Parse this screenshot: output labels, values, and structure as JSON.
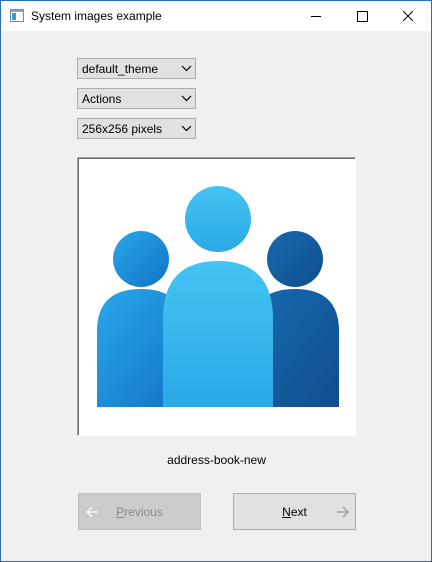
{
  "window": {
    "title": "System images example"
  },
  "controls": {
    "theme_selected": "default_theme",
    "context_selected": "Actions",
    "size_selected": "256x256 pixels"
  },
  "preview": {
    "icon_name": "address-book-new",
    "icon_colors": {
      "back_left": "#1a8fdc",
      "back_right": "#135fa0",
      "front": "#35b6ec"
    }
  },
  "navigation": {
    "previous_mnemonic": "P",
    "previous_rest": "revious",
    "previous_enabled": false,
    "next_mnemonic": "N",
    "next_rest": "ext",
    "next_enabled": true
  }
}
